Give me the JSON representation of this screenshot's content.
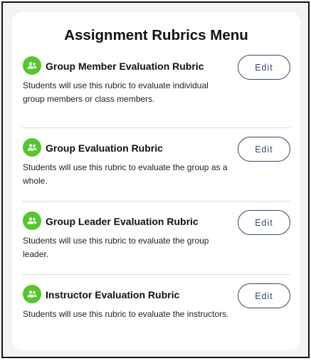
{
  "menu": {
    "title": "Assignment Rubrics Menu",
    "accent_color": "#55c62d",
    "button_color": "#2f4b6a",
    "items": [
      {
        "icon": "group-icon",
        "title": "Group Member Evaluation Rubric",
        "description": "Students will use this rubric to evaluate individual group members or class members.",
        "button_label": "Edit"
      },
      {
        "icon": "group-icon",
        "title": "Group Evaluation Rubric",
        "description": "Students will use this rubric to evaluate the group as a whole.",
        "button_label": "Edit"
      },
      {
        "icon": "group-icon",
        "title": "Group Leader Evaluation Rubric",
        "description": "Students will use this rubric to evaluate the group leader.",
        "button_label": "Edit"
      },
      {
        "icon": "group-icon",
        "title": "Instructor Evaluation Rubric",
        "description": "Students will use this rubric to evaluate the instructors.",
        "button_label": "Edit"
      }
    ]
  }
}
